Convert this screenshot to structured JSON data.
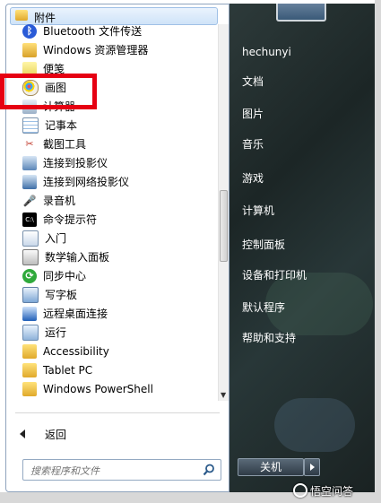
{
  "folder": {
    "label": "附件"
  },
  "items": [
    {
      "label": "Bluetooth 文件传送",
      "icon": "bluetooth-icon"
    },
    {
      "label": "Windows 资源管理器",
      "icon": "explorer-icon"
    },
    {
      "label": "便笺",
      "icon": "sticky-notes-icon"
    },
    {
      "label": "画图",
      "icon": "paint-icon"
    },
    {
      "label": "计算器",
      "icon": "calculator-icon"
    },
    {
      "label": "记事本",
      "icon": "notepad-icon"
    },
    {
      "label": "截图工具",
      "icon": "snipping-tool-icon"
    },
    {
      "label": "连接到投影仪",
      "icon": "projector-icon"
    },
    {
      "label": "连接到网络投影仪",
      "icon": "network-projector-icon"
    },
    {
      "label": "录音机",
      "icon": "microphone-icon"
    },
    {
      "label": "命令提示符",
      "icon": "command-prompt-icon"
    },
    {
      "label": "入门",
      "icon": "getting-started-icon"
    },
    {
      "label": "数学输入面板",
      "icon": "math-input-icon"
    },
    {
      "label": "同步中心",
      "icon": "sync-center-icon"
    },
    {
      "label": "写字板",
      "icon": "wordpad-icon"
    },
    {
      "label": "远程桌面连接",
      "icon": "remote-desktop-icon"
    },
    {
      "label": "运行",
      "icon": "run-icon"
    },
    {
      "label": "Accessibility",
      "icon": "folder-icon"
    },
    {
      "label": "Tablet PC",
      "icon": "folder-icon"
    },
    {
      "label": "Windows PowerShell",
      "icon": "folder-icon"
    }
  ],
  "back_label": "返回",
  "search": {
    "placeholder": "搜索程序和文件"
  },
  "right_menu": {
    "user": "hechunyi",
    "items": [
      "文档",
      "图片",
      "音乐",
      "游戏",
      "计算机",
      "控制面板",
      "设备和打印机",
      "默认程序",
      "帮助和支持"
    ]
  },
  "shutdown_label": "关机",
  "watermark": "悟空问答",
  "colors": {
    "highlight": "#e60012",
    "right_panel": "#1f2a2a"
  }
}
